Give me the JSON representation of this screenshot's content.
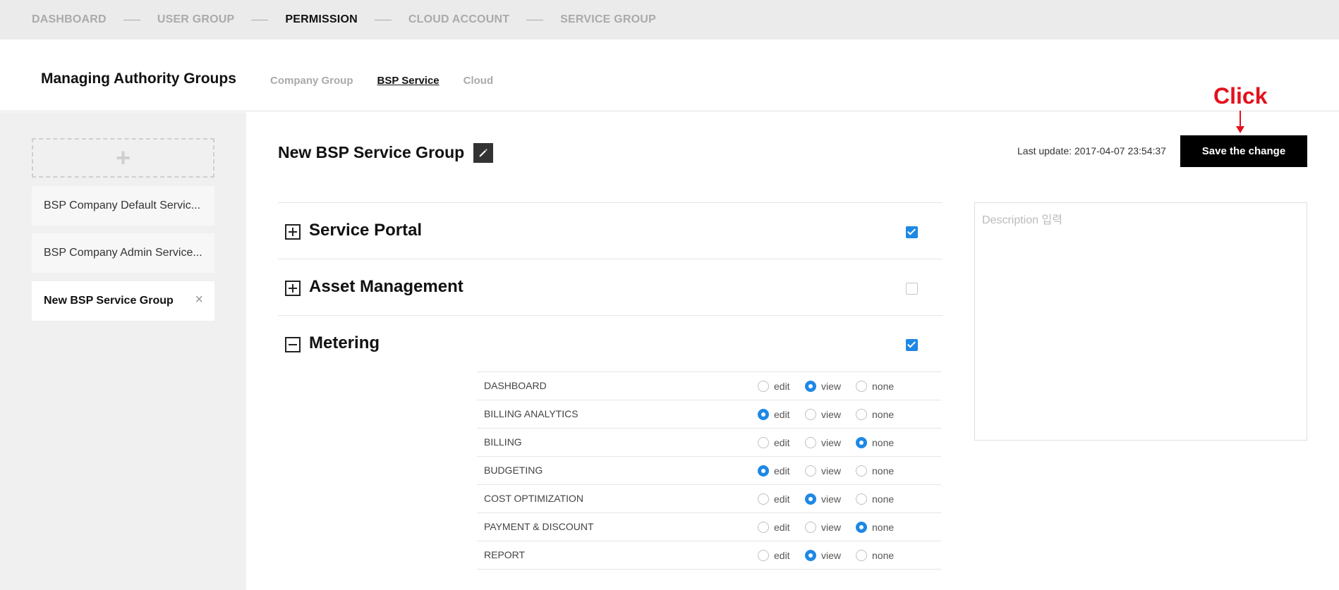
{
  "stepnav": {
    "steps": [
      {
        "label": "DASHBOARD",
        "active": false
      },
      {
        "label": "USER GROUP",
        "active": false
      },
      {
        "label": "PERMISSION",
        "active": true
      },
      {
        "label": "CLOUD ACCOUNT",
        "active": false
      },
      {
        "label": "SERVICE GROUP",
        "active": false
      }
    ]
  },
  "header": {
    "title": "Managing Authority Groups",
    "tabs": [
      {
        "label": "Company Group",
        "active": false
      },
      {
        "label": "BSP Service",
        "active": true
      },
      {
        "label": "Cloud",
        "active": false
      }
    ]
  },
  "sidebar": {
    "add_label": "+",
    "groups": [
      {
        "label": "BSP Company Default Servic...",
        "active": false
      },
      {
        "label": "BSP Company Admin Service...",
        "active": false
      },
      {
        "label": "New BSP Service Group",
        "active": true,
        "close": "×"
      }
    ]
  },
  "main": {
    "group_name": "New BSP Service Group",
    "last_update": "Last update: 2017-04-07 23:54:37",
    "save_label": "Save the change",
    "annotation": "Click",
    "description_placeholder": "Description 입력",
    "accent_color": "#1e88e5",
    "sections": [
      {
        "title": "Service Portal",
        "expanded": false,
        "checked": true
      },
      {
        "title": "Asset Management",
        "expanded": false,
        "checked": false
      },
      {
        "title": "Metering",
        "expanded": true,
        "checked": true
      }
    ],
    "option_labels": {
      "edit": "edit",
      "view": "view",
      "none": "none"
    },
    "permissions": [
      {
        "label": "DASHBOARD",
        "value": "view"
      },
      {
        "label": "BILLING ANALYTICS",
        "value": "edit"
      },
      {
        "label": "BILLING",
        "value": "none"
      },
      {
        "label": "BUDGETING",
        "value": "edit"
      },
      {
        "label": "COST OPTIMIZATION",
        "value": "view"
      },
      {
        "label": "PAYMENT & DISCOUNT",
        "value": "none"
      },
      {
        "label": "REPORT",
        "value": "view"
      }
    ]
  }
}
